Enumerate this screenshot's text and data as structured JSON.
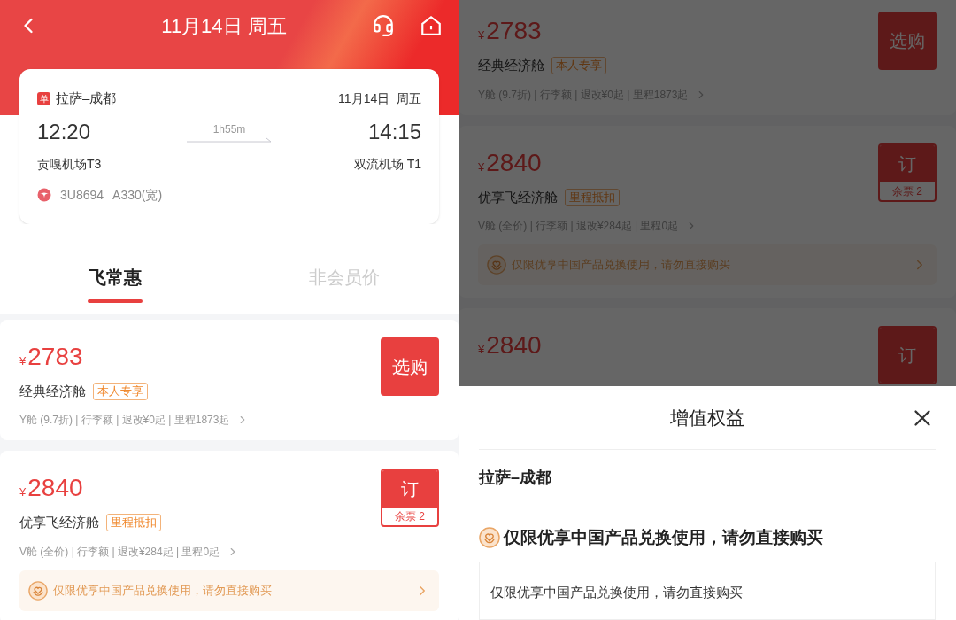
{
  "left": {
    "header": {
      "title": "11月14日 周五"
    },
    "flight": {
      "trip_badge": "单",
      "route": "拉萨–成都",
      "date": "11月14日  周五",
      "depart_time": "12:20",
      "duration": "1h55m",
      "arrive_time": "14:15",
      "depart_airport": "贡嘎机场T3",
      "arrive_airport": "双流机场 T1",
      "flight_no": "3U8694",
      "aircraft": "A330(宽)"
    },
    "tabs": [
      {
        "label": "飞常惠",
        "selected": true
      },
      {
        "label": "非会员价",
        "selected": false
      }
    ],
    "fares": [
      {
        "kind": "select",
        "currency": "¥",
        "price": "2783",
        "cabin": "经典经济舱",
        "tag": "本人专享",
        "details": "Y舱 (9.7折) | 行李额 | 退改¥0起 | 里程1873起",
        "button": "选购"
      },
      {
        "kind": "book",
        "currency": "¥",
        "price": "2840",
        "cabin": "优享飞经济舱",
        "tag": "里程抵扣",
        "details": "V舱 (全价) | 行李额 | 退改¥284起 | 里程0起",
        "button": "订",
        "remaining": "余票 2",
        "notice": "仅限优享中国产品兑换使用，请勿直接购买"
      }
    ]
  },
  "right": {
    "fares": [
      {
        "kind": "select",
        "currency": "¥",
        "price": "2783",
        "cabin": "经典经济舱",
        "tag": "本人专享",
        "details": "Y舱 (9.7折) | 行李额 | 退改¥0起 | 里程1873起",
        "button": "选购"
      },
      {
        "kind": "book",
        "currency": "¥",
        "price": "2840",
        "cabin": "优享飞经济舱",
        "tag": "里程抵扣",
        "details": "V舱 (全价) | 行李额 | 退改¥284起 | 里程0起",
        "button": "订",
        "remaining": "余票 2",
        "notice": "仅限优享中国产品兑换使用，请勿直接购买"
      },
      {
        "kind": "book",
        "currency": "¥",
        "price": "2840",
        "button": "订"
      }
    ],
    "sheet": {
      "title": "增值权益",
      "route": "拉萨–成都",
      "notice_title": "仅限优享中国产品兑换使用，请勿直接购买",
      "notice_text": "仅限优享中国产品兑换使用，请勿直接购买"
    }
  }
}
